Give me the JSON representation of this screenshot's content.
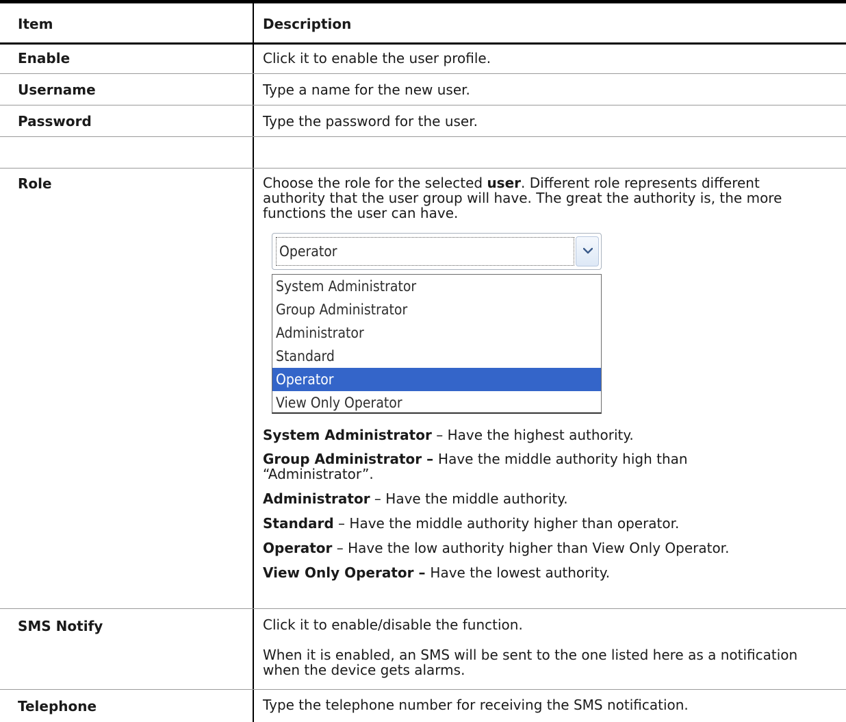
{
  "table": {
    "header": {
      "item": "Item",
      "description": "Description"
    },
    "rows": {
      "enable": {
        "item": "Enable",
        "desc": "Click it to enable the user profile."
      },
      "username": {
        "item": "Username",
        "desc": "Type a name for the new user."
      },
      "password": {
        "item": "Password",
        "desc": "Type the password for the user."
      },
      "role": {
        "item": "Role",
        "intro_pre": "Choose the role for the selected ",
        "intro_bold": "user",
        "intro_post": ". Different role represents different authority that the user group will have. The great the authority is, the more functions the user can have.",
        "dropdown": {
          "selected": "Operator",
          "options": [
            "System Administrator",
            "Group Administrator",
            "Administrator",
            "Standard",
            "Operator",
            "View Only Operator"
          ]
        },
        "defs": [
          {
            "term": "System Administrator",
            "sep": " – ",
            "text": "Have the highest authority."
          },
          {
            "term": "Group Administrator – ",
            "sep": "",
            "text": "Have the middle authority high than “Administrator”."
          },
          {
            "term": "Administrator",
            "sep": " – ",
            "text": "Have the middle authority."
          },
          {
            "term": "Standard",
            "sep": " – ",
            "text": "Have the middle authority higher than operator."
          },
          {
            "term": "Operator",
            "sep": " – ",
            "text": "Have the low authority higher than View Only Operator."
          },
          {
            "term": "View Only Operator – ",
            "sep": "",
            "text": "Have the lowest authority."
          }
        ]
      },
      "sms_notify": {
        "item": "SMS Notify",
        "line1": "Click it to enable/disable the function.",
        "line2": "When it is enabled, an SMS will be sent to the one listed here as a notification when the device gets alarms."
      },
      "telephone": {
        "item": "Telephone",
        "desc": "Type the telephone number for receiving the SMS notification."
      }
    }
  }
}
